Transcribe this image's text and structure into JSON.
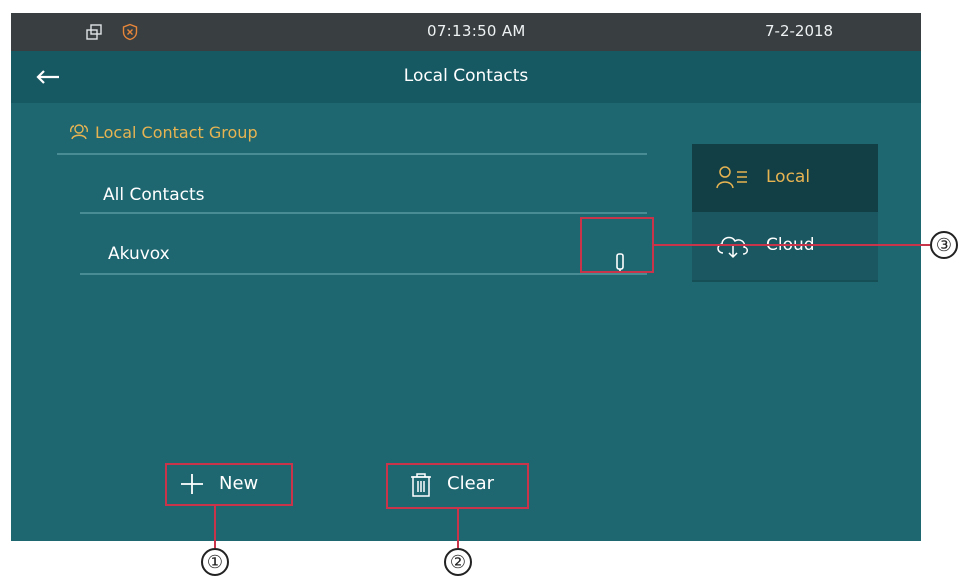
{
  "status_bar": {
    "time": "07:13:50   AM",
    "date": "7-2-2018",
    "icons": [
      "window-icon",
      "shield-icon"
    ]
  },
  "header": {
    "title": "Local Contacts",
    "back_icon": "back-arrow-icon"
  },
  "group": {
    "title": "Local Contact Group",
    "icon": "contacts-group-icon",
    "title_color": "#e7b452",
    "items": [
      {
        "label": "All Contacts"
      },
      {
        "label": "Akuvox",
        "action_icon": "edit-icon"
      }
    ]
  },
  "side_menu": {
    "items": [
      {
        "label": "Local",
        "icon": "local-contacts-icon",
        "active": true,
        "color": "#e7b452"
      },
      {
        "label": "Cloud",
        "icon": "cloud-icon",
        "active": false,
        "color": "#ffffff"
      }
    ]
  },
  "bottom_buttons": {
    "new_label": "New",
    "new_icon": "plus-icon",
    "clear_label": "Clear",
    "clear_icon": "trash-icon"
  },
  "annotations": {
    "callout_1": "①",
    "callout_2": "②",
    "callout_3": "③",
    "color": "#c9344a"
  },
  "colors": {
    "screen_bg": "#1e6670",
    "status_bar_bg": "#393e40",
    "title_bar_bg": "#175963",
    "side_active_bg": "#123f45",
    "accent": "#e7b452"
  }
}
